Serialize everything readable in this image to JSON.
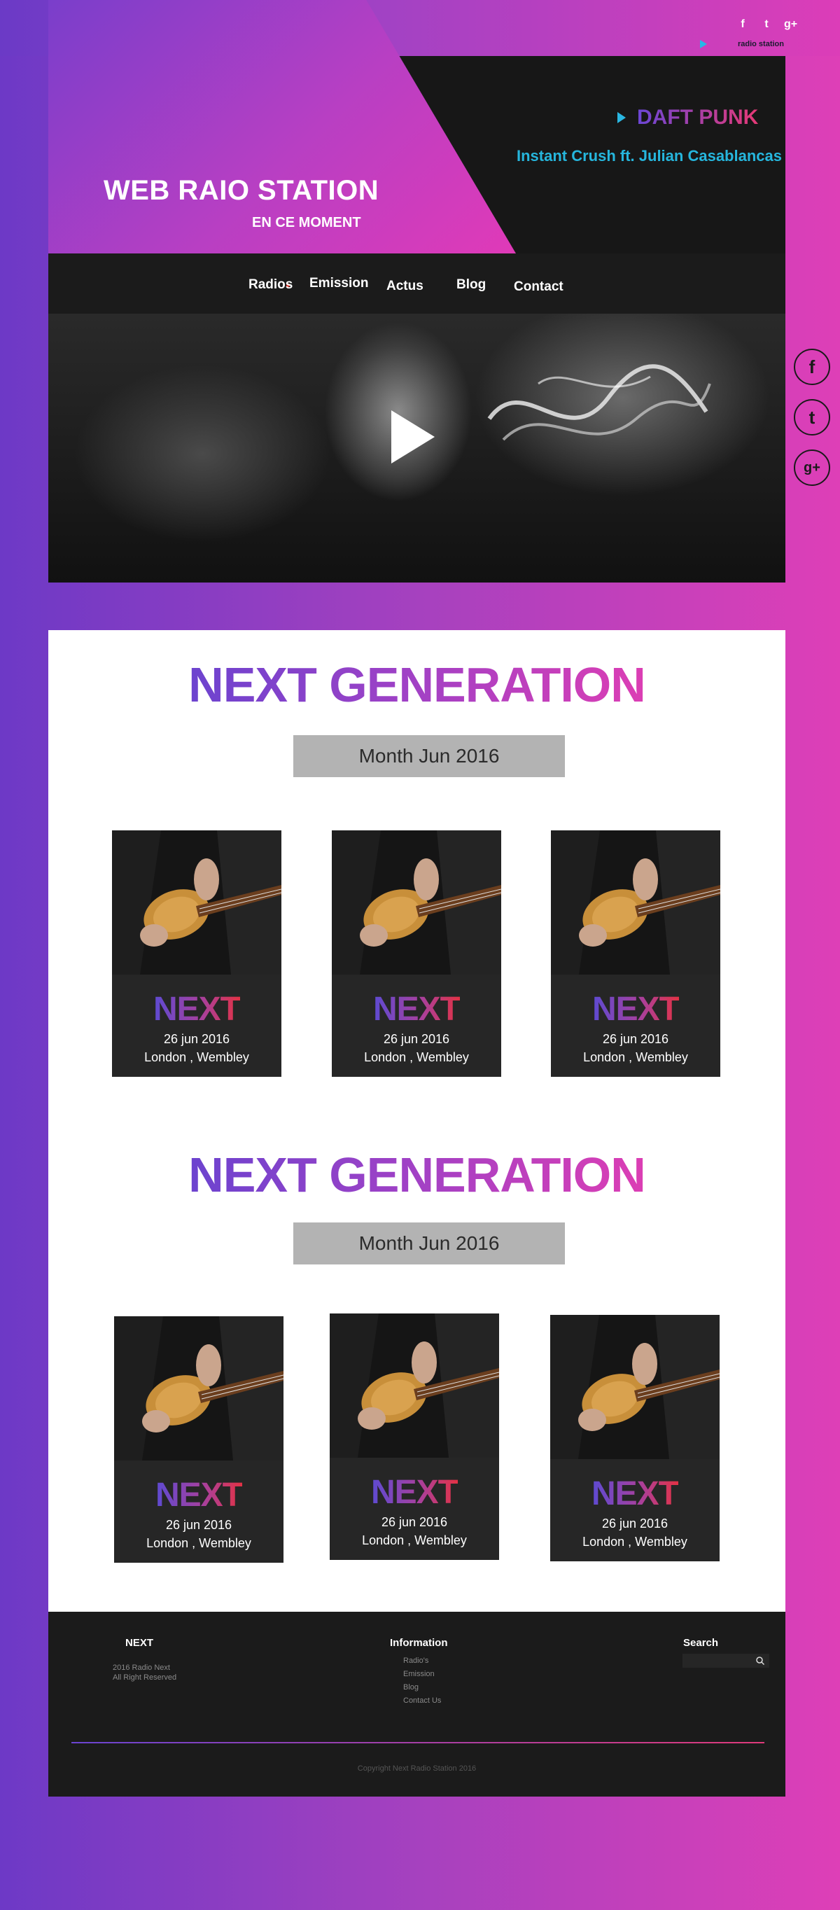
{
  "social_top": {
    "icons": [
      "facebook-icon",
      "twitter-icon",
      "google-plus-icon"
    ],
    "glyphs": [
      "f",
      "t",
      "g+"
    ],
    "station_label": "radio station"
  },
  "header": {
    "title": "WEB RAIO STATION",
    "subtitle": "EN CE MOMENT",
    "now_playing_artist": "DAFT PUNK",
    "now_playing_track": "Instant Crush ft. Julian Casablancas"
  },
  "nav": {
    "items": [
      {
        "label": "Radios"
      },
      {
        "label": "Emission"
      },
      {
        "label": "Actus"
      },
      {
        "label": "Blog"
      },
      {
        "label": "Contact"
      }
    ]
  },
  "side_social": {
    "icons": [
      "facebook-icon",
      "twitter-icon",
      "google-plus-icon"
    ],
    "glyphs": [
      "f",
      "t",
      "g+"
    ]
  },
  "sections": [
    {
      "title": "NEXT GENERATION",
      "month": "Month Jun 2016",
      "cards": [
        {
          "title": "NEXT",
          "date": "26 jun 2016",
          "place": "London , Wembley"
        },
        {
          "title": "NEXT",
          "date": "26 jun 2016",
          "place": "London , Wembley"
        },
        {
          "title": "NEXT",
          "date": "26 jun 2016",
          "place": "London , Wembley"
        }
      ]
    },
    {
      "title": "NEXT GENERATION",
      "month": "Month Jun 2016",
      "cards": [
        {
          "title": "NEXT",
          "date": "26 jun 2016",
          "place": "London , Wembley"
        },
        {
          "title": "NEXT",
          "date": "26 jun 2016",
          "place": "London , Wembley"
        },
        {
          "title": "NEXT",
          "date": "26 jun 2016",
          "place": "London , Wembley"
        }
      ]
    }
  ],
  "footer": {
    "col1_title": "NEXT",
    "col1_line1": "2016 Radio Next",
    "col1_line2": "All Right Reserved",
    "col2_title": "Information",
    "col2_links": [
      "Radio's",
      "Emission",
      "Blog",
      "Contact Us"
    ],
    "col3_title": "Search",
    "copyright": "Copyright Next Radio Station 2016"
  }
}
